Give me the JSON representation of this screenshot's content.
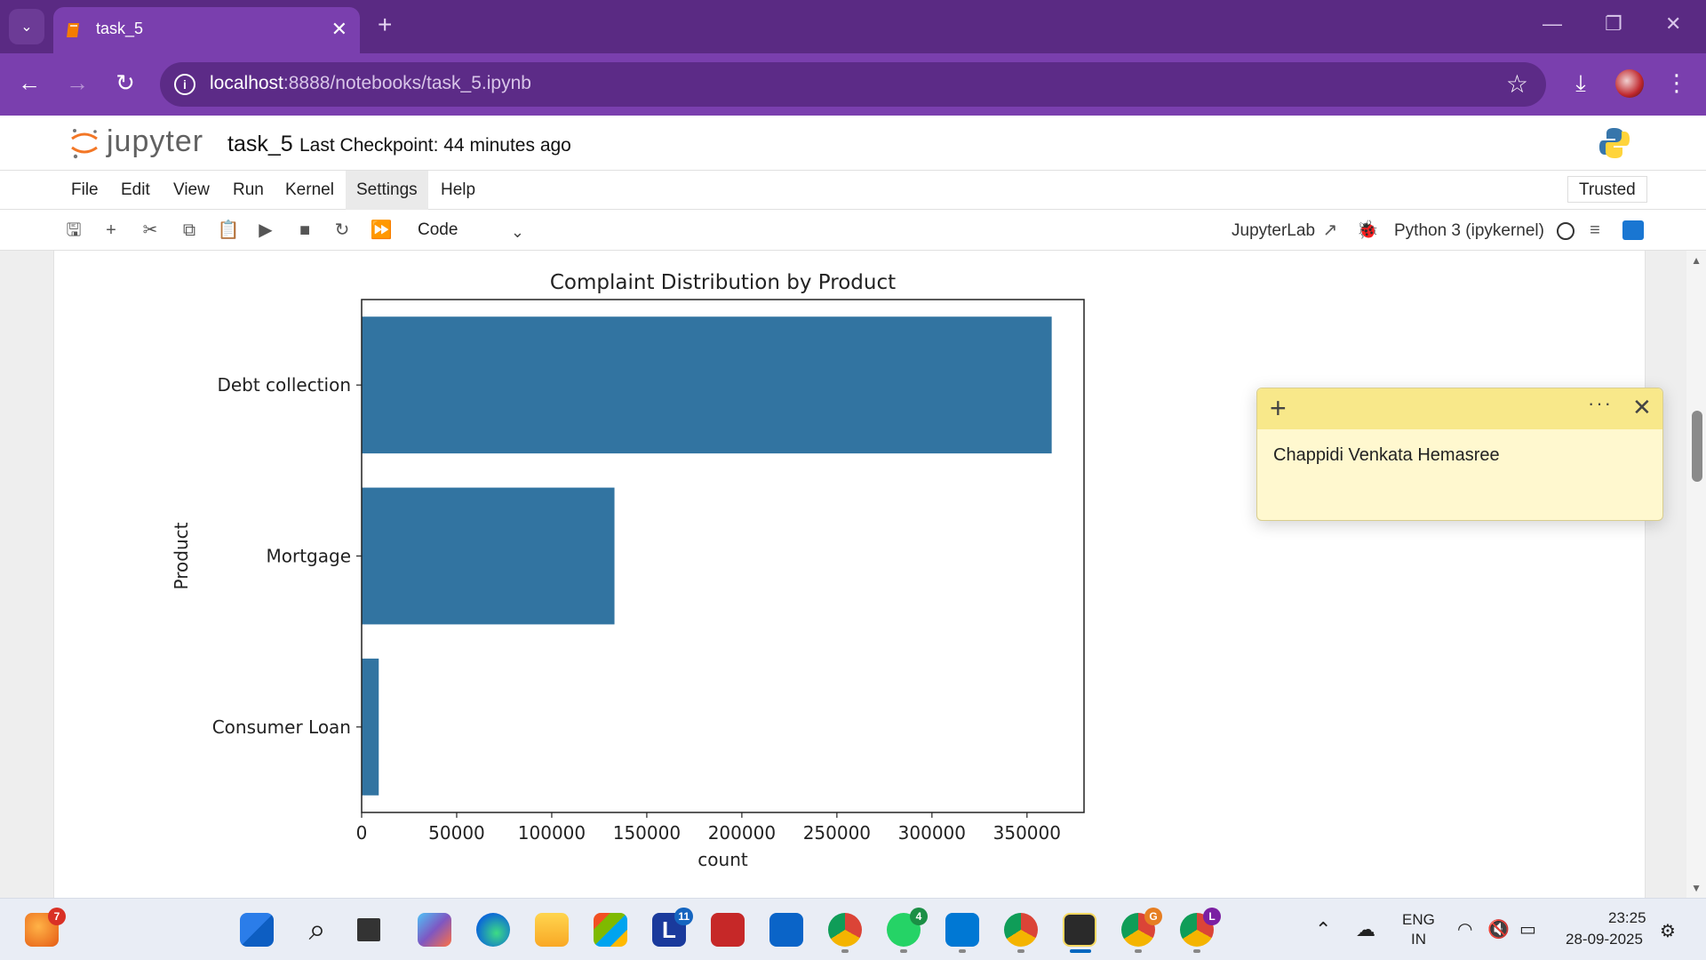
{
  "browser": {
    "tab_title": "task_5",
    "url_host": "localhost",
    "url_path": ":8888/notebooks/task_5.ipynb",
    "tab_close": "✕",
    "new_tab": "+",
    "min": "—",
    "restore": "❐",
    "close": "✕"
  },
  "jupyter": {
    "logo_text": "jupyter",
    "notebook_name": "task_5",
    "checkpoint": "Last Checkpoint: 44 minutes ago",
    "trusted": "Trusted",
    "menu": [
      "File",
      "Edit",
      "View",
      "Run",
      "Kernel",
      "Settings",
      "Help"
    ],
    "cell_type": "Code",
    "jupyterlab_link": "JupyterLab",
    "kernel_name": "Python 3 (ipykernel)"
  },
  "chart_data": {
    "type": "bar",
    "orientation": "horizontal",
    "title": "Complaint Distribution by Product",
    "xlabel": "count",
    "ylabel": "Product",
    "categories": [
      "Debt collection",
      "Mortgage",
      "Consumer Loan"
    ],
    "values": [
      363000,
      133000,
      9000
    ],
    "xlim": [
      0,
      380000
    ],
    "xticks": [
      0,
      50000,
      100000,
      150000,
      200000,
      250000,
      300000,
      350000
    ],
    "xtick_labels": [
      "0",
      "50000",
      "100000",
      "150000",
      "200000",
      "250000",
      "300000",
      "350000"
    ],
    "bar_color": "#3274a1",
    "grid": false
  },
  "sticky_note": {
    "text": "Chappidi Venkata Hemasree",
    "plus": "+",
    "more": "···",
    "close": "✕"
  },
  "taskbar": {
    "badges": {
      "firefox": "7",
      "lexis": "11",
      "whatsapp": "4",
      "chrome_g": "G",
      "chrome_l": "L"
    },
    "lang_top": "ENG",
    "lang_bottom": "IN",
    "time": "23:25",
    "date": "28-09-2025"
  }
}
